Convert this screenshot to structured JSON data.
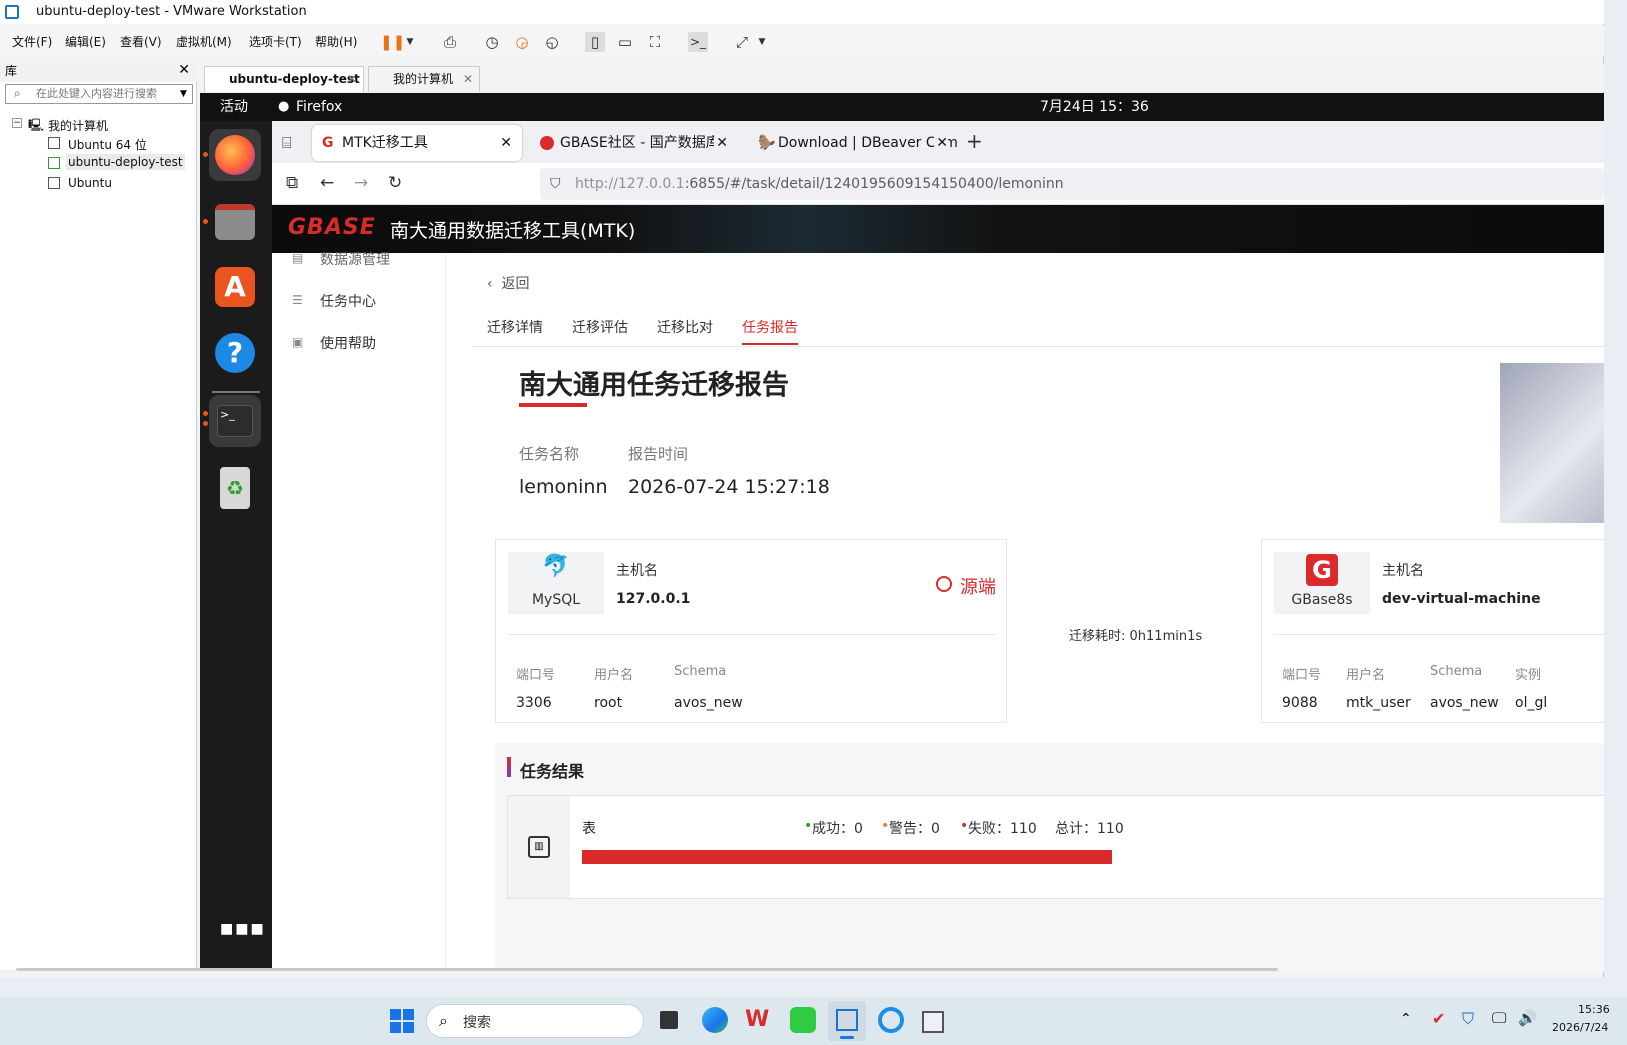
{
  "window": {
    "title": "ubuntu-deploy-test - VMware Workstation"
  },
  "menu": [
    "文件(F)",
    "编辑(E)",
    "查看(V)",
    "虚拟机(M)",
    "选项卡(T)",
    "帮助(H)"
  ],
  "library": {
    "title": "库",
    "search_placeholder": "在此处键入内容进行搜索",
    "root": "我的计算机",
    "items": [
      "Ubuntu 64 位",
      "ubuntu-deploy-test",
      "Ubuntu"
    ]
  },
  "vm_tabs": [
    "ubuntu-deploy-test",
    "我的计算机"
  ],
  "ubuntu": {
    "activities": "活动",
    "app": "Firefox",
    "clock": "7月24日  15：36",
    "tooltip": "终端"
  },
  "firefox": {
    "tabs": [
      "MTK迁移工具",
      "GBASE社区 - 国产数据库扌",
      "Download | DBeaver Com"
    ],
    "url_host": "http://127.0.0.1",
    "url_path": ":6855/#/task/detail/1240195609154150400/lemoninn"
  },
  "app": {
    "logo": "GBASE",
    "title": "南大通用数据迁移工具(MTK)",
    "side": [
      "数据源管理",
      "任务中心",
      "使用帮助"
    ],
    "back": "返回",
    "tabs": [
      "迁移详情",
      "迁移评估",
      "迁移比对",
      "任务报告"
    ],
    "report_title": "南大通用任务迁移报告",
    "task_name_label": "任务名称",
    "task_name": "lemoninn",
    "report_time_label": "报告时间",
    "report_time": "2026-07-24 15:27:18",
    "source": {
      "db": "MySQL",
      "host_label": "主机名",
      "host": "127.0.0.1",
      "tag": "源端",
      "port_label": "端口号",
      "port": "3306",
      "user_label": "用户名",
      "user": "root",
      "schema_label": "Schema",
      "schema": "avos_new"
    },
    "duration": "迁移耗时: 0h11min1s",
    "target": {
      "db": "GBase8s",
      "host_label": "主机名",
      "host": "dev-virtual-machine",
      "port_label": "端口号",
      "port": "9088",
      "user_label": "用户名",
      "user": "mtk_user",
      "schema_label": "Schema",
      "schema": "avos_new",
      "instance_label": "实例",
      "instance": "ol_gl"
    },
    "result_title": "任务结果",
    "result": {
      "object": "表",
      "success": "成功：0",
      "warning": "警告：0",
      "fail": "失败：110",
      "total": "总计：110",
      "fail_ratio": 1.0
    }
  },
  "taskbar": {
    "search": "搜索",
    "time": "15:36",
    "date": "2026/7/24"
  },
  "colors": {
    "accent": "#d92b2b",
    "success": "#2e9e2e",
    "warning": "#e6862b"
  }
}
